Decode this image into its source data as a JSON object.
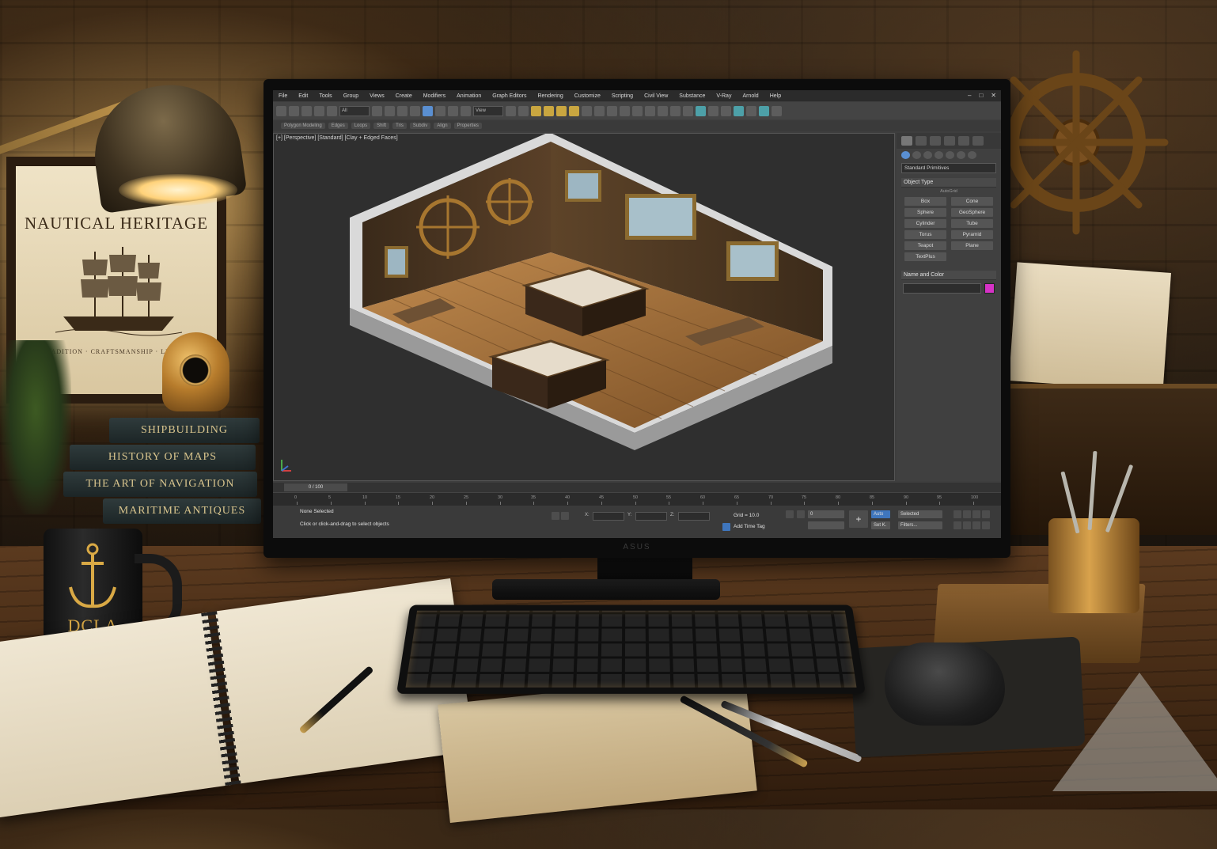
{
  "scene": {
    "poster": {
      "title": "NAUTICAL HERITAGE",
      "subtitle": "TRADITION · CRAFTSMANSHIP · LEGACY"
    },
    "books": [
      "SHIPBUILDING",
      "HISTORY OF MAPS",
      "THE ART OF NAVIGATION",
      "MARITIME ANTIQUES"
    ],
    "mug_text": "DCLA",
    "monitor_brand": "ASUS"
  },
  "app": {
    "menu": [
      "File",
      "Edit",
      "Tools",
      "Group",
      "Views",
      "Create",
      "Modifiers",
      "Animation",
      "Graph Editors",
      "Rendering",
      "Customize",
      "Scripting",
      "Civil View",
      "Substance",
      "V-Ray",
      "Arnold",
      "Help"
    ],
    "window_controls": [
      "–",
      "□",
      "✕"
    ],
    "toolbar_dropdowns": [
      "All",
      "View"
    ],
    "ribbon_items": [
      "Polygon Modeling",
      "Edges",
      "Loops",
      "Shift",
      "Tris",
      "Subdiv",
      "Align",
      "Properties"
    ],
    "viewport_label": "[+] [Perspective] [Standard] [Clay + Edged Faces]",
    "command_panel": {
      "category": "Standard Primitives",
      "object_type_title": "Object Type",
      "autogrid": "AutoGrid",
      "primitives": [
        "Box",
        "Cone",
        "Sphere",
        "GeoSphere",
        "Cylinder",
        "Tube",
        "Torus",
        "Pyramid",
        "Teapot",
        "Plane",
        "TextPlus"
      ],
      "name_color_title": "Name and Color",
      "swatch_color": "#d632c6"
    },
    "timeline": {
      "frame_display": "0 / 100",
      "ticks": [
        "0",
        "5",
        "10",
        "15",
        "20",
        "25",
        "30",
        "35",
        "40",
        "45",
        "50",
        "55",
        "60",
        "65",
        "70",
        "75",
        "80",
        "85",
        "90",
        "95",
        "100"
      ]
    },
    "status": {
      "selection": "None Selected",
      "prompt": "Click or click-and-drag to select objects",
      "x_label": "X:",
      "y_label": "Y:",
      "z_label": "Z:",
      "grid": "Grid = 10.0",
      "add_time_tag": "Add Time Tag",
      "auto_key": "Auto",
      "set_key": "Set K.",
      "key_mode": "Selected",
      "filters": "Filters...",
      "frame_field": "0"
    }
  }
}
